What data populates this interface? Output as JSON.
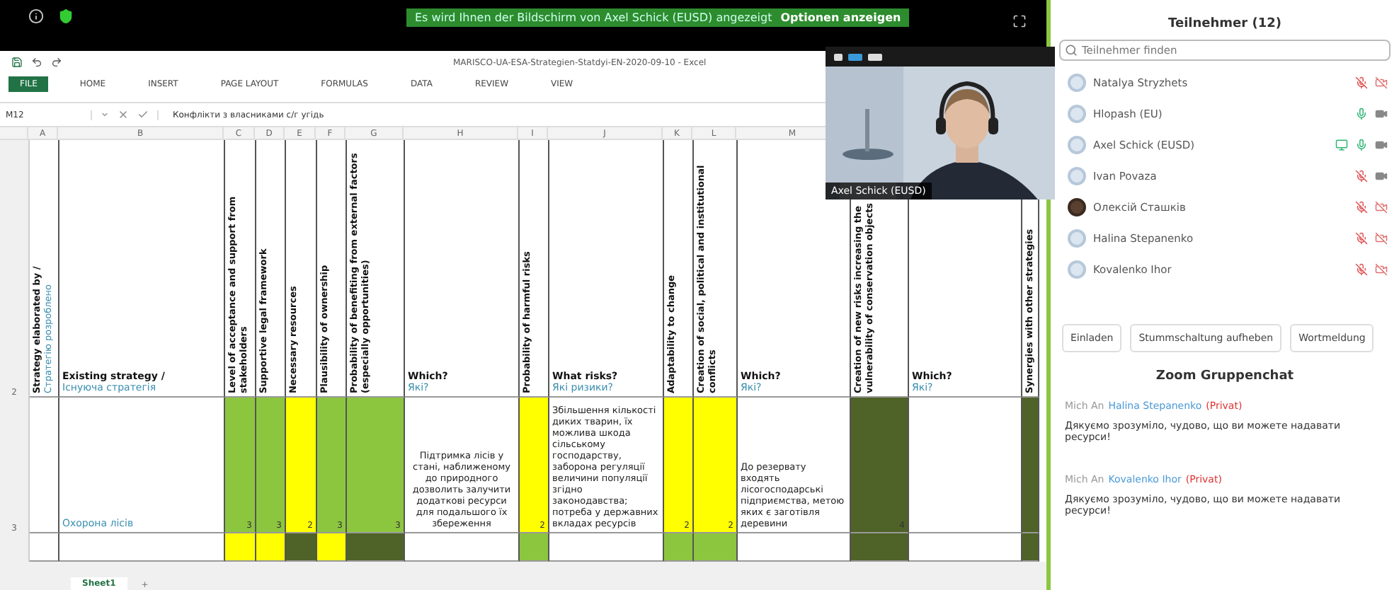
{
  "top_bar": {
    "banner": "Es wird Ihnen der Bildschirm von Axel Schick (EUSD) angezeigt",
    "options": "Optionen anzeigen"
  },
  "excel": {
    "title": "MARISCO-UA-ESA-Strategien-Statdyi-EN-2020-09-10 - Excel",
    "ribbon_tabs": [
      {
        "label": "FILE",
        "selected": true
      },
      {
        "label": "HOME",
        "selected": false
      },
      {
        "label": "INSERT",
        "selected": false
      },
      {
        "label": "PAGE LAYOUT",
        "selected": false
      },
      {
        "label": "FORMULAS",
        "selected": false
      },
      {
        "label": "DATA",
        "selected": false
      },
      {
        "label": "REVIEW",
        "selected": false
      },
      {
        "label": "VIEW",
        "selected": false
      }
    ],
    "name_box": "M12",
    "formula": "Конфлікти з власниками с/г угідь",
    "row_numbers": [
      "2",
      "3"
    ],
    "columns": [
      {
        "letter": "A",
        "title": "Strategy elaborated by /",
        "subtitle": "Стратегію розроблено"
      },
      {
        "letter": "B",
        "title": "Existing strategy /",
        "subtitle": "Існуюча стратегія",
        "data": {
          "text": "Охорона лісів"
        }
      },
      {
        "letter": "C",
        "title": "Level of acceptance and support from stakeholders",
        "data": {
          "value": "3",
          "color": "#8cc63f"
        },
        "bottom": {
          "color": "#ffff00"
        }
      },
      {
        "letter": "D",
        "title": "Supportive legal framework",
        "data": {
          "value": "3",
          "color": "#8cc63f"
        },
        "bottom": {
          "color": "#ffff00"
        }
      },
      {
        "letter": "E",
        "title": "Necessary resources",
        "data": {
          "value": "2",
          "color": "#ffff00"
        },
        "bottom": {
          "color": "#4f6228"
        }
      },
      {
        "letter": "F",
        "title": "Plausibility of ownership",
        "data": {
          "value": "3",
          "color": "#8cc63f"
        },
        "bottom": {
          "color": "#ffff00"
        }
      },
      {
        "letter": "G",
        "title": "Probability of benefiting from external factors (especially opportunities)",
        "data": {
          "value": "3",
          "color": "#8cc63f"
        },
        "bottom": {
          "color": "#4f6228"
        }
      },
      {
        "letter": "H",
        "title": "Which?",
        "subtitle": "Які?",
        "data": {
          "text": "Підтримка лісів у стані, наближеному до природного дозволить залучити додаткові ресурси для подальшого їх збереження"
        }
      },
      {
        "letter": "I",
        "title": "Probability of harmful risks",
        "data": {
          "value": "2",
          "color": "#ffff00"
        },
        "bottom": {
          "color": "#8cc63f"
        }
      },
      {
        "letter": "J",
        "title": "What risks?",
        "subtitle": "Які ризики?",
        "data": {
          "text": "Збільшення кількості диких тварин, їх можлива шкода сільському господарству, заборона регуляції величини популяції згідно законодавства; потреба у державних вкладах ресурсів"
        }
      },
      {
        "letter": "K",
        "title": "Adaptability to change",
        "data": {
          "value": "2",
          "color": "#ffff00"
        },
        "bottom": {
          "color": "#8cc63f"
        }
      },
      {
        "letter": "L",
        "title": "Creation of social, political and institutional conflicts",
        "data": {
          "value": "2",
          "color": "#ffff00"
        },
        "bottom": {
          "color": "#8cc63f"
        }
      },
      {
        "letter": "M",
        "title": "Which?",
        "subtitle": "Які?",
        "data": {
          "text": "До резервату входять лісогосподарські підприємства, метою яких є заготівля деревини"
        }
      },
      {
        "title": "Creation of new risks increasing the vulnerability of conservation objects",
        "data": {
          "value": "4",
          "color": "#4f6228"
        },
        "bottom": {
          "color": "#4f6228"
        }
      },
      {
        "title": "Which?",
        "subtitle": "Які?"
      },
      {
        "title": "Synergies with other strategies",
        "data": {
          "color": "#4f6228"
        },
        "bottom": {
          "color": "#4f6228"
        }
      }
    ],
    "sheet_tabs": [
      {
        "label": "Sheet1",
        "selected": true
      }
    ],
    "add_sheet": "+"
  },
  "video_tile": {
    "name": "Axel Schick (EUSD)"
  },
  "participants": {
    "title": "Teilnehmer (12)",
    "search_placeholder": "Teilnehmer finden",
    "items": [
      {
        "name": "Natalya Stryzhets",
        "muted": true,
        "video_off": true,
        "sharing": false,
        "photo": false
      },
      {
        "name": "Hlopash (EU)",
        "muted": false,
        "video_off": false,
        "sharing": false,
        "photo": false
      },
      {
        "name": "Axel Schick (EUSD)",
        "muted": false,
        "video_off": false,
        "sharing": true,
        "photo": false
      },
      {
        "name": "Ivan Povaza",
        "muted": true,
        "video_off": false,
        "sharing": false,
        "photo": false
      },
      {
        "name": "Олексій Сташків",
        "muted": true,
        "video_off": true,
        "sharing": false,
        "photo": true
      },
      {
        "name": "Halina Stepanenko",
        "muted": true,
        "video_off": true,
        "sharing": false,
        "photo": false
      },
      {
        "name": "Kovalenko Ihor",
        "muted": true,
        "video_off": true,
        "sharing": false,
        "photo": false
      }
    ],
    "buttons": [
      "Einladen",
      "Stummschaltung aufheben",
      "Wortmeldung"
    ]
  },
  "chat": {
    "title": "Zoom Gruppenchat",
    "messages": [
      {
        "from": "Mich An",
        "to": "Halina Stepanenko",
        "tag": "(Privat)",
        "text": "Дякуємо зрозуміло, чудово, що ви можете надавати ресурси!"
      },
      {
        "from": "Mich An",
        "to": "Kovalenko Ihor",
        "tag": "(Privat)",
        "text": "Дякуємо зрозуміло, чудово, що ви можете надавати ресурси!"
      }
    ]
  }
}
